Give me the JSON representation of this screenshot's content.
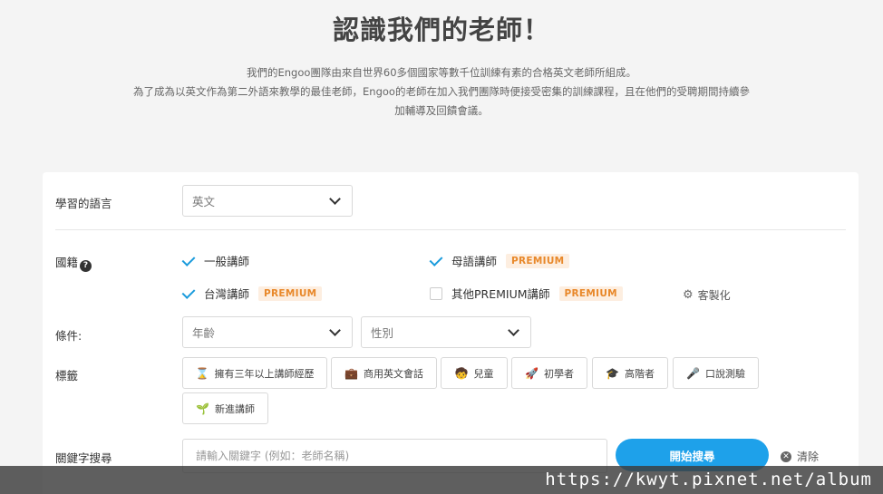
{
  "header": {
    "title": "認識我們的老師！",
    "intro_lines": [
      "我們的Engoo團隊由來自世界60多個國家等數千位訓練有素的合格英文老師所組成。",
      "為了成為以英文作為第二外語來教學的最佳老師，Engoo的老師在加入我們團隊時便接受密集的訓練課程，且在他們的受聘期間持續參",
      "加輔導及回饋會議。"
    ]
  },
  "filters": {
    "language": {
      "label": "學習的語言",
      "value": "英文"
    },
    "nationality": {
      "label": "國籍",
      "help_icon": "?",
      "options": [
        {
          "label": "一般講師",
          "checked": true,
          "badge": ""
        },
        {
          "label": "母語講師",
          "checked": true,
          "badge": "PREMIUM"
        },
        {
          "label": "台灣講師",
          "checked": true,
          "badge": "PREMIUM"
        },
        {
          "label": "其他PREMIUM講師",
          "checked": false,
          "badge": "PREMIUM"
        }
      ],
      "customize_label": "客製化"
    },
    "conditions": {
      "label": "條件:",
      "age": "年齡",
      "gender": "性別"
    },
    "tags": {
      "label": "標籤",
      "items": [
        {
          "label": "擁有三年以上講師經歷",
          "icon": "hourglass-icon"
        },
        {
          "label": "商用英文會話",
          "icon": "briefcase-icon"
        },
        {
          "label": "兒童",
          "icon": "child-icon"
        },
        {
          "label": "初學者",
          "icon": "rocket-icon"
        },
        {
          "label": "高階者",
          "icon": "graduation-cap-icon"
        },
        {
          "label": "口說測驗",
          "icon": "microphone-icon"
        },
        {
          "label": "新進講師",
          "icon": "sprout-icon"
        }
      ]
    },
    "keyword": {
      "label": "關鍵字搜尋",
      "placeholder": "請輸入關鍵字 (例如：老師名稱)",
      "search_button": "開始搜尋",
      "clear_label": "清除"
    }
  },
  "watermark": "https://kwyt.pixnet.net/album",
  "colors": {
    "accent": "#1ea1ea",
    "check": "#1a9bdc",
    "badge_text": "#e8882a",
    "badge_bg": "#fdeee0"
  }
}
